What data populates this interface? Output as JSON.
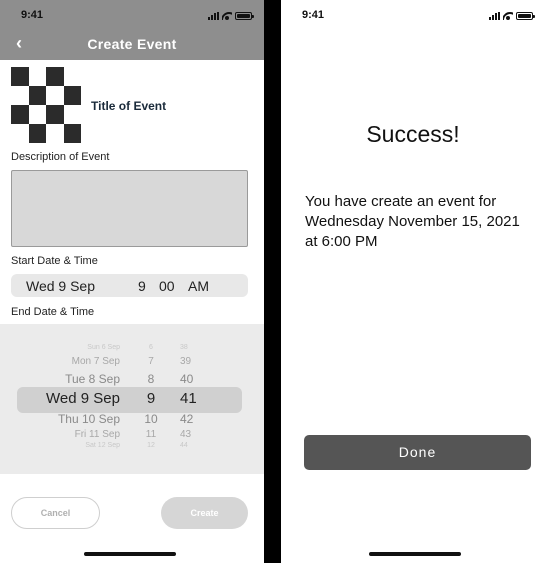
{
  "left_screen": {
    "status_time": "9:41",
    "back_icon": "chevron-left-icon",
    "title": "Create Event",
    "event_title": "Title of Event",
    "description_label": "Description of Event",
    "start_label": "Start Date & Time",
    "start_value": {
      "date": "Wed 9 Sep",
      "hour": "9",
      "minute": "00",
      "ampm": "AM"
    },
    "end_label": "End Date & Time",
    "picker_rows": [
      {
        "date": "Sun 6 Sep",
        "hour": "6",
        "minute": "38"
      },
      {
        "date": "Mon 7 Sep",
        "hour": "7",
        "minute": "39"
      },
      {
        "date": "Tue 8 Sep",
        "hour": "8",
        "minute": "40"
      },
      {
        "date": "Wed 9 Sep",
        "hour": "9",
        "minute": "41"
      },
      {
        "date": "Thu 10 Sep",
        "hour": "10",
        "minute": "42"
      },
      {
        "date": "Fri 11 Sep",
        "hour": "11",
        "minute": "43"
      },
      {
        "date": "Sat 12 Sep",
        "hour": "12",
        "minute": "44"
      }
    ],
    "cancel_label": "Cancel",
    "create_label": "Create"
  },
  "right_screen": {
    "status_time": "9:41",
    "success_title": "Success!",
    "success_message": "You have create an event for Wednesday November 15, 2021 at 6:00 PM",
    "done_label": "Done"
  }
}
